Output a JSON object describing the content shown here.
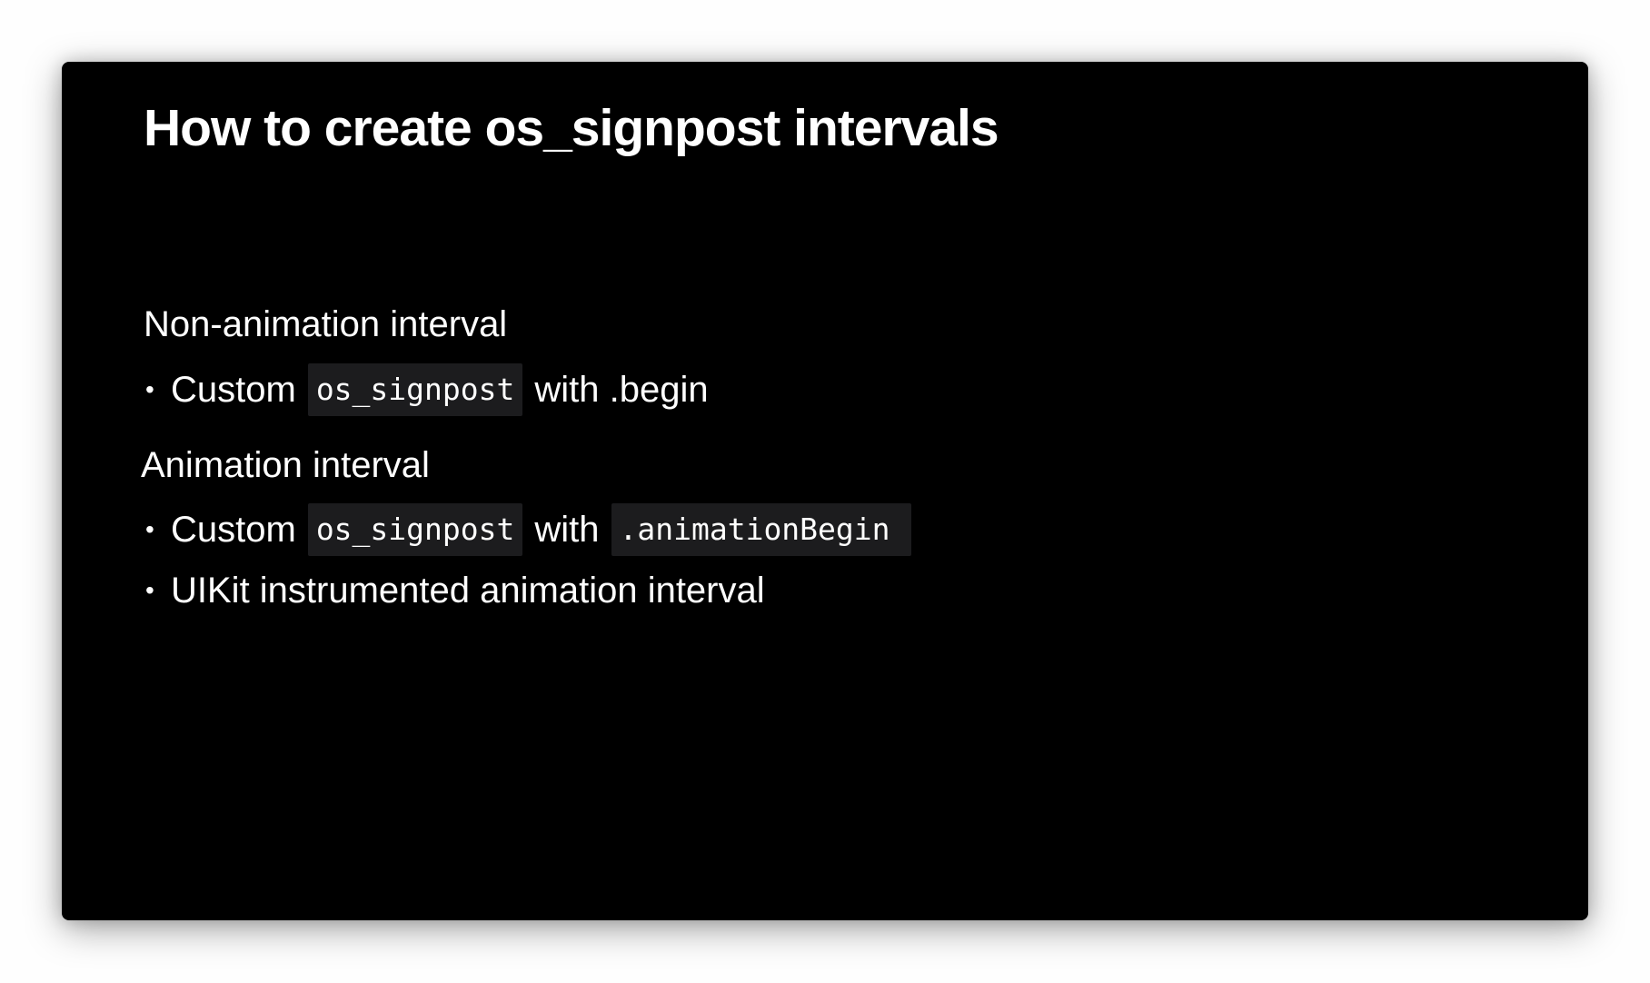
{
  "slide": {
    "title": "How to create os_signpost intervals",
    "sections": [
      {
        "heading": "Non-animation interval",
        "bullets": [
          {
            "prefix": "Custom",
            "code": "os_signpost",
            "suffix": "with .begin"
          }
        ]
      },
      {
        "heading": "Animation interval",
        "bullets": [
          {
            "prefix": "Custom",
            "code": "os_signpost",
            "middle": "with",
            "code2": ".animationBegin"
          },
          {
            "text": "UIKit instrumented animation interval"
          }
        ]
      }
    ],
    "bullet_glyph": "•"
  },
  "colors": {
    "slide_background": "#000000",
    "text": "#ffffff",
    "code_background": "#1c1c1e"
  }
}
